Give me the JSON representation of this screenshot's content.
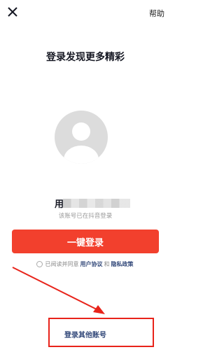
{
  "header": {
    "close_icon": "close-icon",
    "help_label": "帮助"
  },
  "title": "登录发现更多精彩",
  "account": {
    "avatar_icon": "default-avatar-icon",
    "name_visible_prefix": "用",
    "hint": "该账号已在抖音登录"
  },
  "login_button_label": "一键登录",
  "agreement": {
    "text_before": "已阅读并同意",
    "user_agreement": "用户协议",
    "and": "和",
    "privacy_policy": "隐私政策"
  },
  "other_account_label": "登录其他账号",
  "colors": {
    "primary": "#f2402d",
    "link": "#33497a",
    "annotation": "#e8231a"
  }
}
